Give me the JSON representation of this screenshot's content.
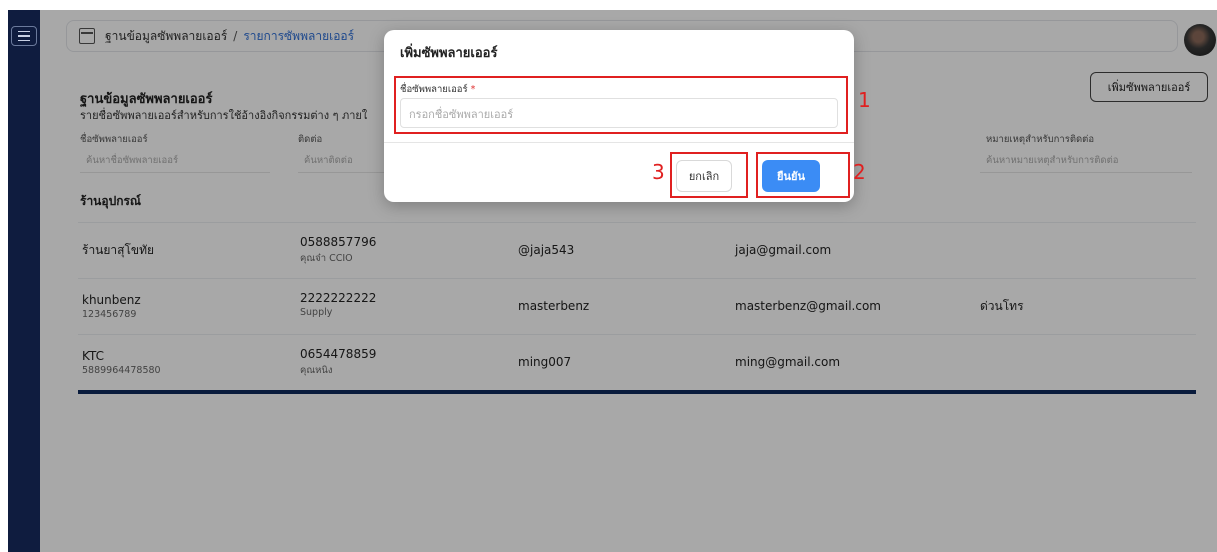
{
  "breadcrumb": {
    "root": "ฐานข้อมูลซัพพลายเออร์",
    "separator": "/",
    "current": "รายการซัพพลายเออร์"
  },
  "page": {
    "title": "ฐานข้อมูลซัพพลายเออร์",
    "subtitle": "รายชื่อซัพพลายเออร์สำหรับการใช้อ้างอิงกิจกรรมต่าง ๆ ภายใ",
    "add_button": "เพิ่มซัพพลายเออร์"
  },
  "filters": [
    {
      "label": "ชื่อซัพพลายเออร์",
      "placeholder": "ค้นหาชื่อซัพพลายเออร์"
    },
    {
      "label": "ติดต่อ",
      "placeholder": "ค้นหาติดต่อ"
    },
    {
      "label": "หมายเหตุสำหรับการติดต่อ",
      "placeholder": "ค้นหาหมายเหตุสำหรับการติดต่อ"
    }
  ],
  "group": "ร้านอุปกรณ์",
  "rows": [
    {
      "name": "ร้านยาสุโขทัย",
      "sub": "",
      "phone": "0588857796",
      "contact": "คุณจ๋า CCIO",
      "line": "@jaja543",
      "email": "jaja@gmail.com",
      "note": ""
    },
    {
      "name": "khunbenz",
      "sub": "123456789",
      "phone": "2222222222",
      "contact": "Supply",
      "line": "masterbenz",
      "email": "masterbenz@gmail.com",
      "note": "ด่วนโทร"
    },
    {
      "name": "KTC",
      "sub": "5889964478580",
      "phone": "0654478859",
      "contact": "คุณหนิง",
      "line": "ming007",
      "email": "ming@gmail.com",
      "note": ""
    }
  ],
  "modal": {
    "title": "เพิ่มซัพพลายเออร์",
    "field_label": "ชื่อซัพพลายเออร์",
    "required_mark": "*",
    "field_placeholder": "กรอกชื่อซัพพลายเออร์",
    "cancel": "ยกเลิก",
    "confirm": "ยืนยัน"
  },
  "callouts": {
    "one": "1",
    "two": "2",
    "three": "3"
  },
  "colors": {
    "accent": "#3b8cf5",
    "sidebar": "#0f1c3f",
    "callout": "#e02020"
  }
}
